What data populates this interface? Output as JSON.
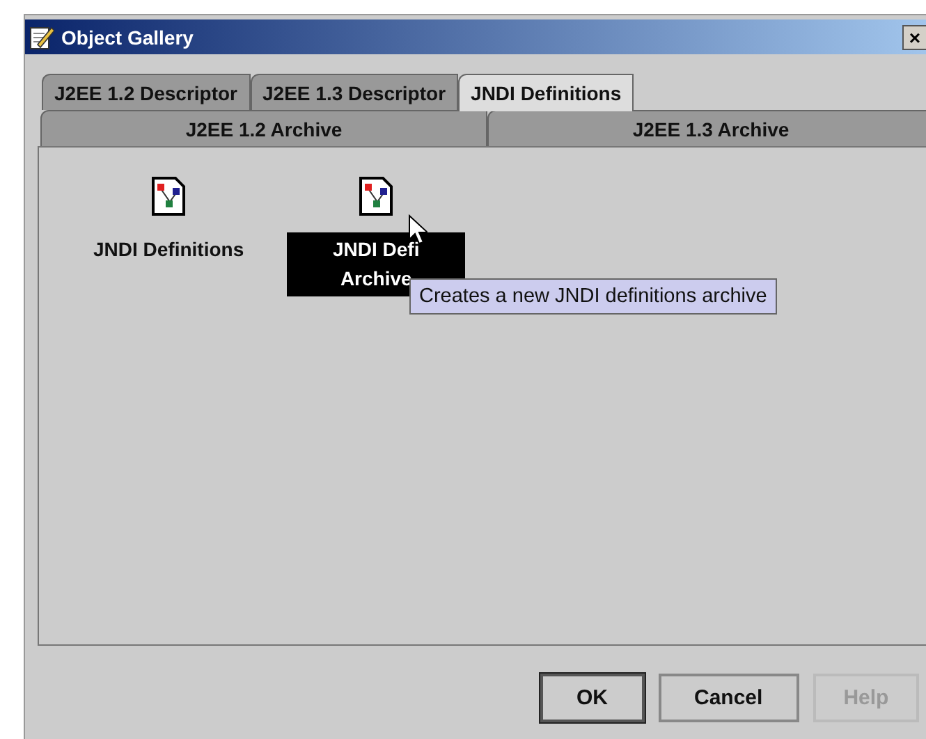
{
  "window": {
    "title": "Object Gallery",
    "close": "×"
  },
  "tabs_row1": [
    {
      "label": "J2EE 1.2 Descriptor",
      "selected": false
    },
    {
      "label": "J2EE 1.3 Descriptor",
      "selected": false
    },
    {
      "label": "JNDI Definitions",
      "selected": true
    }
  ],
  "tabs_row2": [
    {
      "label": "J2EE 1.2 Archive",
      "selected": false
    },
    {
      "label": "J2EE 1.3 Archive",
      "selected": false
    }
  ],
  "items": [
    {
      "label_lines": [
        "JNDI Definitions"
      ],
      "selected": false
    },
    {
      "label_lines": [
        "JNDI Defi",
        "Archive"
      ],
      "selected": true
    }
  ],
  "tooltip": "Creates a new JNDI definitions archive",
  "buttons": [
    {
      "label": "OK",
      "disabled": false,
      "default": true
    },
    {
      "label": "Cancel",
      "disabled": false,
      "default": false
    },
    {
      "label": "Help",
      "disabled": true,
      "default": false
    }
  ]
}
